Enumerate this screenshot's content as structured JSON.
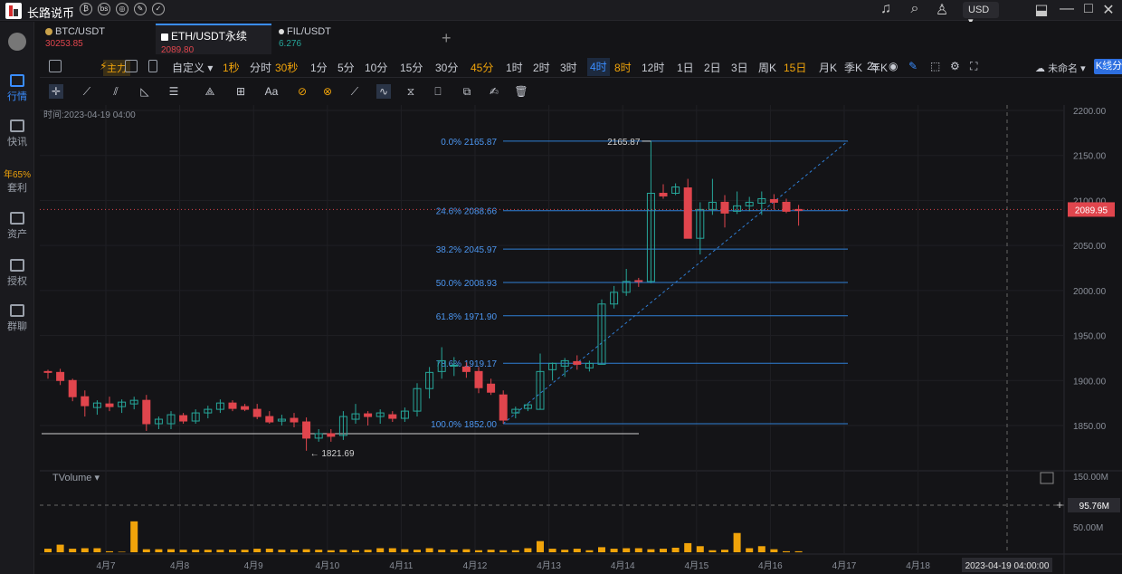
{
  "app": {
    "title": "长路说币",
    "currency": "USD"
  },
  "sidebar": [
    {
      "label": "行情",
      "active": true
    },
    {
      "label": "快讯"
    },
    {
      "label": "套利",
      "badge": "年65%"
    },
    {
      "label": "资产"
    },
    {
      "label": "授权"
    },
    {
      "label": "群聊"
    }
  ],
  "tabs": [
    {
      "pair": "BTC/USDT",
      "price": "30253.85",
      "price_color": "#e0454d"
    },
    {
      "pair": "ETH/USDT永续",
      "price": "2089.80",
      "price_color": "#e0454d",
      "active": true
    },
    {
      "pair": "FIL/USDT",
      "price": "6.276",
      "price_color": "#26a69a"
    }
  ],
  "toolbar": {
    "main_label": "主力",
    "custom": "自定义",
    "timeframes": [
      "1秒",
      "分时",
      "30秒",
      "1分",
      "5分",
      "10分",
      "15分",
      "30分",
      "45分",
      "1时",
      "2时",
      "3时",
      "4时",
      "8时",
      "12时",
      "1日",
      "2日",
      "3日",
      "周K",
      "15日",
      "月K",
      "季K",
      "年K"
    ],
    "selected": "4时",
    "highlighted": [
      "1秒",
      "30秒",
      "45分",
      "8时",
      "15日"
    ],
    "refresh": "2s",
    "layout_name": "未命名",
    "analysis_button": "K线分析"
  },
  "chart_data": {
    "type": "candlestick",
    "time_label": "时间:2023-04-19 04:00",
    "y_ticks": [
      "2200.00",
      "2150.00",
      "2100.00",
      "2050.00",
      "2000.00",
      "1950.00",
      "1900.00",
      "1850.00"
    ],
    "x_ticks": [
      "4月7",
      "4月8",
      "4月9",
      "4月10",
      "4月11",
      "4月12",
      "4月13",
      "4月14",
      "4月15",
      "4月16",
      "4月17",
      "4月18"
    ],
    "crosshair_date": "2023-04-19 04:00:00",
    "last_price": "2089.95",
    "high_label": "2165.87",
    "low_label": "← 1821.69",
    "fib_levels": [
      {
        "label": "0.0% 2165.87",
        "value": 2165.87
      },
      {
        "label": "24.6% 2088.66",
        "value": 2088.66
      },
      {
        "label": "38.2% 2045.97",
        "value": 2045.97
      },
      {
        "label": "50.0% 2008.93",
        "value": 2008.93
      },
      {
        "label": "61.8% 1971.90",
        "value": 1971.9
      },
      {
        "label": "78.6% 1919.17",
        "value": 1919.17
      },
      {
        "label": "100.0% 1852.00",
        "value": 1852.0
      }
    ],
    "hline": 1841,
    "volume_label": "TVolume",
    "volume_ticks": [
      "150.00M",
      "50.00M"
    ],
    "volume_crosshair": "95.76M",
    "bars": [
      [
        0,
        1910,
        1912,
        1902,
        1909
      ],
      [
        1,
        1909,
        1913,
        1895,
        1900
      ],
      [
        2,
        1900,
        1902,
        1877,
        1882
      ],
      [
        3,
        1882,
        1889,
        1860,
        1872
      ],
      [
        4,
        1870,
        1878,
        1862,
        1875
      ],
      [
        5,
        1874,
        1882,
        1866,
        1871
      ],
      [
        6,
        1871,
        1879,
        1864,
        1876
      ],
      [
        7,
        1874,
        1882,
        1868,
        1878
      ],
      [
        8,
        1878,
        1884,
        1844,
        1852
      ],
      [
        9,
        1852,
        1860,
        1846,
        1857
      ],
      [
        10,
        1852,
        1866,
        1846,
        1862
      ],
      [
        11,
        1861,
        1864,
        1852,
        1855
      ],
      [
        12,
        1855,
        1868,
        1852,
        1864
      ],
      [
        13,
        1864,
        1872,
        1858,
        1868
      ],
      [
        14,
        1868,
        1879,
        1864,
        1875
      ],
      [
        15,
        1875,
        1878,
        1866,
        1869
      ],
      [
        16,
        1871,
        1874,
        1866,
        1868
      ],
      [
        17,
        1868,
        1874,
        1857,
        1860
      ],
      [
        18,
        1860,
        1866,
        1852,
        1854
      ],
      [
        19,
        1855,
        1862,
        1850,
        1857
      ],
      [
        20,
        1858,
        1864,
        1848,
        1854
      ],
      [
        21,
        1854,
        1859,
        1822,
        1836
      ],
      [
        22,
        1836,
        1846,
        1832,
        1841
      ],
      [
        23,
        1841,
        1846,
        1832,
        1838
      ],
      [
        24,
        1839,
        1866,
        1834,
        1860
      ],
      [
        25,
        1857,
        1874,
        1852,
        1863
      ],
      [
        26,
        1863,
        1866,
        1850,
        1860
      ],
      [
        27,
        1860,
        1868,
        1852,
        1864
      ],
      [
        28,
        1862,
        1866,
        1854,
        1858
      ],
      [
        29,
        1858,
        1870,
        1854,
        1866
      ],
      [
        30,
        1866,
        1897,
        1860,
        1891
      ],
      [
        31,
        1891,
        1915,
        1880,
        1909
      ],
      [
        32,
        1910,
        1937,
        1902,
        1922
      ],
      [
        33,
        1917,
        1926,
        1905,
        1917
      ],
      [
        34,
        1915,
        1920,
        1903,
        1910
      ],
      [
        35,
        1910,
        1915,
        1886,
        1892
      ],
      [
        36,
        1896,
        1902,
        1884,
        1887
      ],
      [
        37,
        1884,
        1889,
        1852,
        1856
      ],
      [
        38,
        1864,
        1871,
        1858,
        1868
      ],
      [
        39,
        1869,
        1875,
        1866,
        1873
      ],
      [
        40,
        1868,
        1930,
        1868,
        1910
      ],
      [
        41,
        1912,
        1920,
        1900,
        1919
      ],
      [
        42,
        1916,
        1925,
        1904,
        1922
      ],
      [
        43,
        1921,
        1928,
        1912,
        1918
      ],
      [
        44,
        1914,
        1922,
        1910,
        1919
      ],
      [
        45,
        1918,
        1990,
        1918,
        1985
      ],
      [
        46,
        1985,
        2005,
        1980,
        1998
      ],
      [
        47,
        1998,
        2024,
        1994,
        2010
      ],
      [
        48,
        2011,
        2014,
        2004,
        2010
      ],
      [
        49,
        2010,
        2166,
        2008,
        2108
      ],
      [
        50,
        2108,
        2118,
        2102,
        2105
      ],
      [
        51,
        2108,
        2119,
        2106,
        2115
      ],
      [
        52,
        2114,
        2124,
        2062,
        2058
      ],
      [
        53,
        2058,
        2098,
        2040,
        2090
      ],
      [
        54,
        2090,
        2124,
        2084,
        2098
      ],
      [
        55,
        2098,
        2106,
        2070,
        2086
      ],
      [
        56,
        2088,
        2110,
        2085,
        2094
      ],
      [
        57,
        2094,
        2104,
        2088,
        2098
      ],
      [
        58,
        2097,
        2110,
        2084,
        2102
      ],
      [
        59,
        2101,
        2107,
        2090,
        2098
      ],
      [
        60,
        2098,
        2102,
        2086,
        2088
      ],
      [
        61,
        2090,
        2095,
        2072,
        2089
      ]
    ],
    "volumes": [
      7,
      15,
      7,
      8,
      8,
      2,
      1,
      61,
      6,
      6,
      6,
      5,
      5,
      5,
      5,
      5,
      5,
      7,
      7,
      5,
      5,
      6,
      5,
      4,
      5,
      4,
      5,
      8,
      8,
      6,
      5,
      8,
      5,
      5,
      6,
      4,
      5,
      4,
      4,
      8,
      22,
      7,
      5,
      7,
      4,
      10,
      7,
      8,
      8,
      6,
      7,
      9,
      18,
      12,
      4,
      5,
      38,
      8,
      12,
      6,
      2,
      2
    ]
  }
}
